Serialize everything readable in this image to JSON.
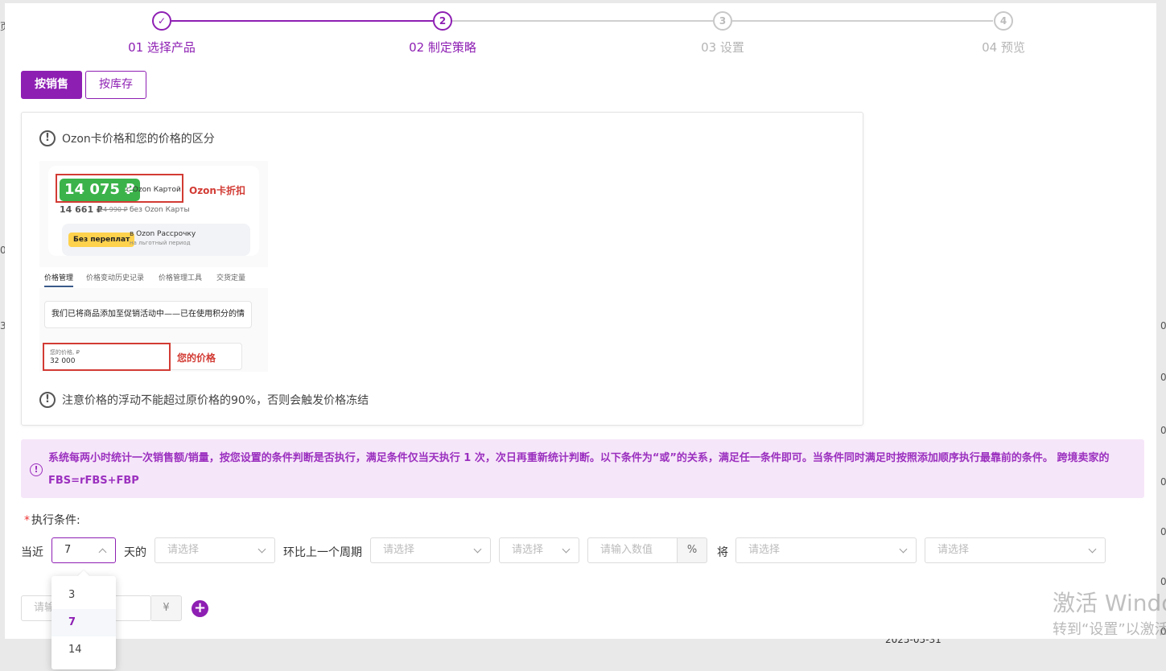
{
  "steps": [
    {
      "label": "01 选择产品",
      "marker": "✓",
      "state": "done"
    },
    {
      "label": "02 制定策略",
      "marker": "2",
      "state": "active"
    },
    {
      "label": "03 设置",
      "marker": "3",
      "state": "pending"
    },
    {
      "label": "04 预览",
      "marker": "4",
      "state": "pending"
    }
  ],
  "colors": {
    "accent": "#8e1fb3",
    "banner_bg": "#f6e6f9",
    "banner_text": "#9b30bf",
    "ozon_green": "#3bb34a",
    "red_box": "#d23b34"
  },
  "mode_tabs": {
    "by_sales": "按销售",
    "by_stock": "按库存"
  },
  "info": {
    "heading": "Ozon卡价格和您的价格的区分",
    "warning": "注意价格的浮动不能超过原价格的90%，否则会触发价格冻结",
    "icon": "alert-circle-icon",
    "illustration": {
      "card_price": "14 075 ₽",
      "card_price_note": "с Ozon Картой",
      "card_label": "Ozon卡折扣",
      "regular_price": "14 661 ₽",
      "old_price": "24 990 ₽",
      "regular_note": "без Ozon Карты",
      "installment_tag": "Без переплат",
      "installment_line1": "в Ozon Рассрочку",
      "installment_line2": "на льготный период",
      "tabs": [
        "价格管理",
        "价格变动历史记录",
        "价格管理工具",
        "交货定量"
      ],
      "notice": "我们已将商品添加至促销活动中——已在使用积分的情",
      "your_price_caption": "您的价格, ₽",
      "your_price_value": "32 000",
      "your_price_label": "您的价格"
    }
  },
  "banner": {
    "icon": "alert-circle-icon",
    "text": "系统每两小时统计一次销售额/销量，按您设置的条件判断是否执行，满足条件仅当天执行 1 次，次日再重新统计判断。以下条件为“或”的关系，满足任一条件即可。当条件同时满足时按照添加顺序执行最靠前的条件。 跨境卖家的FBS=rFBS+FBP"
  },
  "condition": {
    "required_mark": "*",
    "label": "执行条件:",
    "prefix": "当近",
    "days_value": "7",
    "days_suffix": "天的",
    "metric_placeholder": "请选择",
    "compare_text": "环比上一个周期",
    "direction_placeholder": "请选择",
    "operator_placeholder": "请选择",
    "value_placeholder": "请输入数值",
    "percent_unit": "%",
    "action_word": "将",
    "action_placeholder": "请选择",
    "action_detail_placeholder": "请选择",
    "amount_placeholder": "请输",
    "currency_unit": "¥",
    "add_label": "+"
  },
  "dropdown": {
    "options": [
      "3",
      "7",
      "14"
    ],
    "selected": "7"
  },
  "background": {
    "fragments": [
      "页",
      "0",
      "3",
      "0",
      "0",
      "0",
      "0",
      "0",
      "0",
      "0"
    ],
    "date": "2025-05-31"
  },
  "watermark": {
    "line1": "激活 Windows",
    "line2": "转到“设置”以激活"
  }
}
